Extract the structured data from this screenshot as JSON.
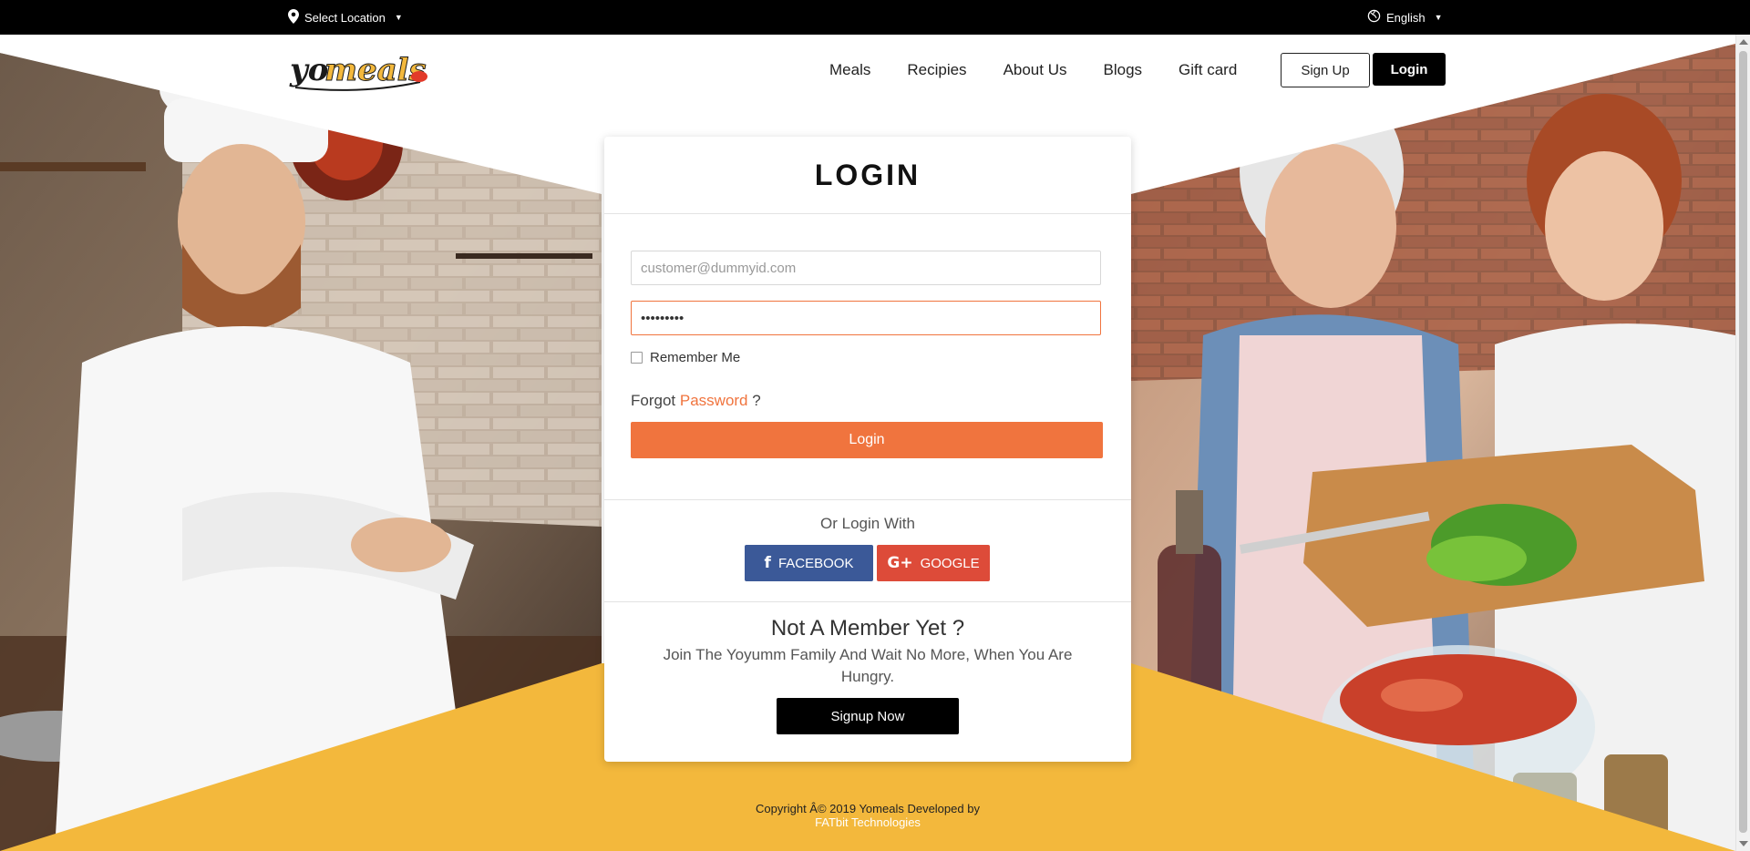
{
  "topbar": {
    "location_label": "Select Location",
    "language_label": "English",
    "location_icon": "map-pin-icon",
    "language_icon": "globe-icon"
  },
  "brand": {
    "logo_text": "yomeals",
    "accent_color": "#f0743e",
    "yellow_color": "#f3b83c"
  },
  "nav": {
    "items": [
      {
        "label": "Meals"
      },
      {
        "label": "Recipies"
      },
      {
        "label": "About Us"
      },
      {
        "label": "Blogs"
      },
      {
        "label": "Gift card"
      }
    ],
    "signup_label": "Sign Up",
    "login_label": "Login"
  },
  "login_card": {
    "title": "LOGIN",
    "email_placeholder": "customer@dummyid.com",
    "password_value": "•••••••••",
    "remember_label": "Remember Me",
    "forgot_prefix": "Forgot",
    "forgot_link": "Password",
    "forgot_suffix": "?",
    "login_button": "Login",
    "or_login_with": "Or Login With",
    "facebook_label": "FACEBOOK",
    "google_label": "GOOGLE",
    "not_member_title": "Not A Member Yet ?",
    "not_member_text": "Join The Yoyumm Family And Wait No More, When You Are Hungry.",
    "signup_now_label": "Signup Now"
  },
  "footer": {
    "copyright": "Copyright Â© 2019 Yomeals Developed by",
    "developer": "FATbit Technologies"
  }
}
